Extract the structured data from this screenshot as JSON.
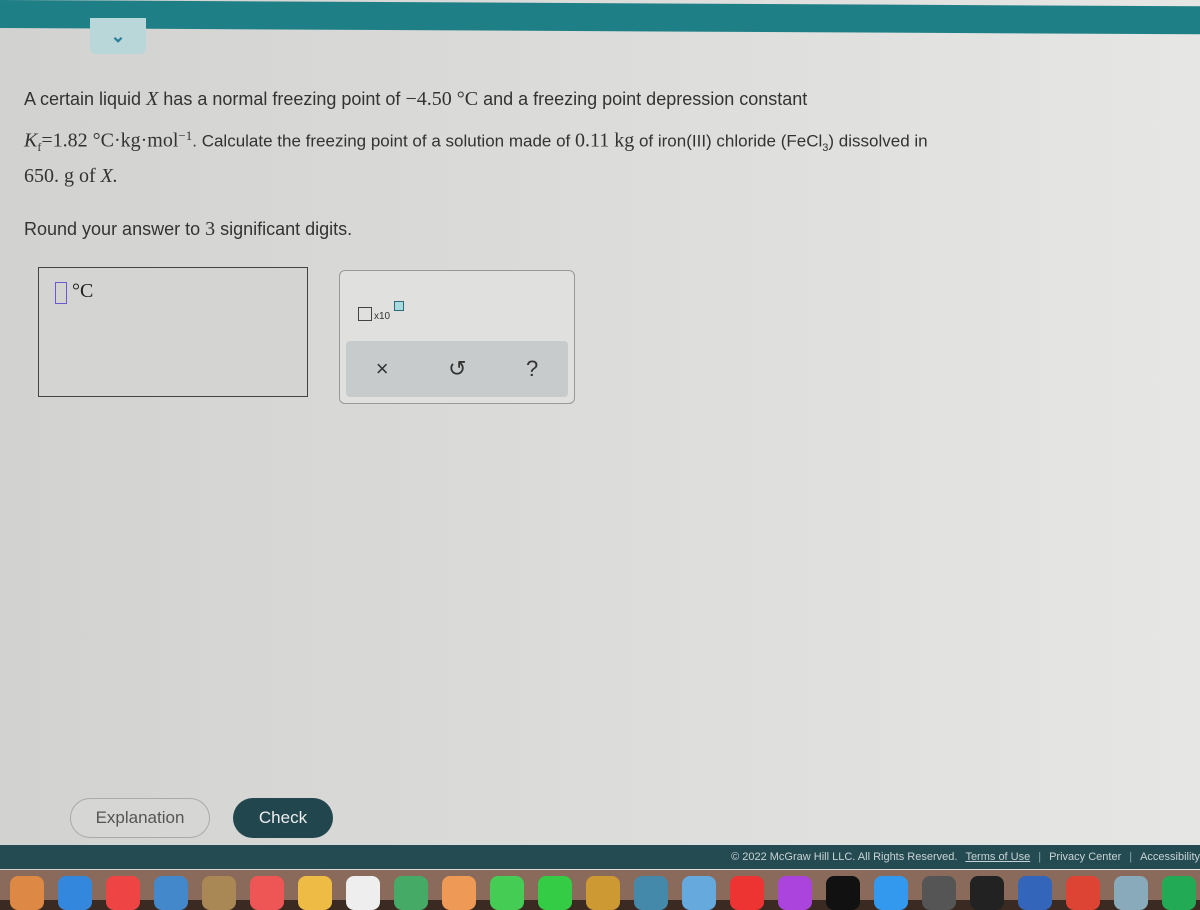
{
  "question": {
    "line1_pre": "A certain liquid ",
    "var": "X",
    "line1_mid": " has a normal freezing point of ",
    "fp": "−4.50 °C",
    "line1_post": " and a freezing point depression constant",
    "kf_sym": "K",
    "kf_sub": "f",
    "kf_val": "=1.82 °C·kg·mol",
    "kf_exp": "−1",
    "line2_post": ". Calculate the freezing point of a solution made of ",
    "mass_solute": "0.11 kg",
    "line2_post2": " of iron(III) chloride ",
    "formula_pre": "(FeCl",
    "formula_sub": "3",
    "formula_post": ")",
    "line2_end": " dissolved in",
    "line3_mass": "650. g",
    "line3_mid": " of ",
    "line3_var": "X.",
    "instruction_pre": "Round your answer to ",
    "instruction_num": "3",
    "instruction_post": " significant digits."
  },
  "answer": {
    "value": "",
    "unit": "°C"
  },
  "keypad": {
    "sci_label": "x10",
    "clear": "×",
    "undo": "↺",
    "help": "?"
  },
  "buttons": {
    "explanation": "Explanation",
    "check": "Check"
  },
  "footer": {
    "copyright": "© 2022 McGraw Hill LLC. All Rights Reserved.",
    "terms": "Terms of Use",
    "privacy": "Privacy Center",
    "accessibility": "Accessibility"
  },
  "dock_colors": [
    "#d84",
    "#38d",
    "#e44",
    "#48c",
    "#a85",
    "#e55",
    "#eb4",
    "#eee",
    "#4a6",
    "#e95",
    "#4c5",
    "#3c4",
    "#c93",
    "#48a",
    "#6ad",
    "#e33",
    "#a4d",
    "#111",
    "#39e",
    "#555",
    "#222",
    "#36b",
    "#d43",
    "#8ab",
    "#2a5"
  ]
}
